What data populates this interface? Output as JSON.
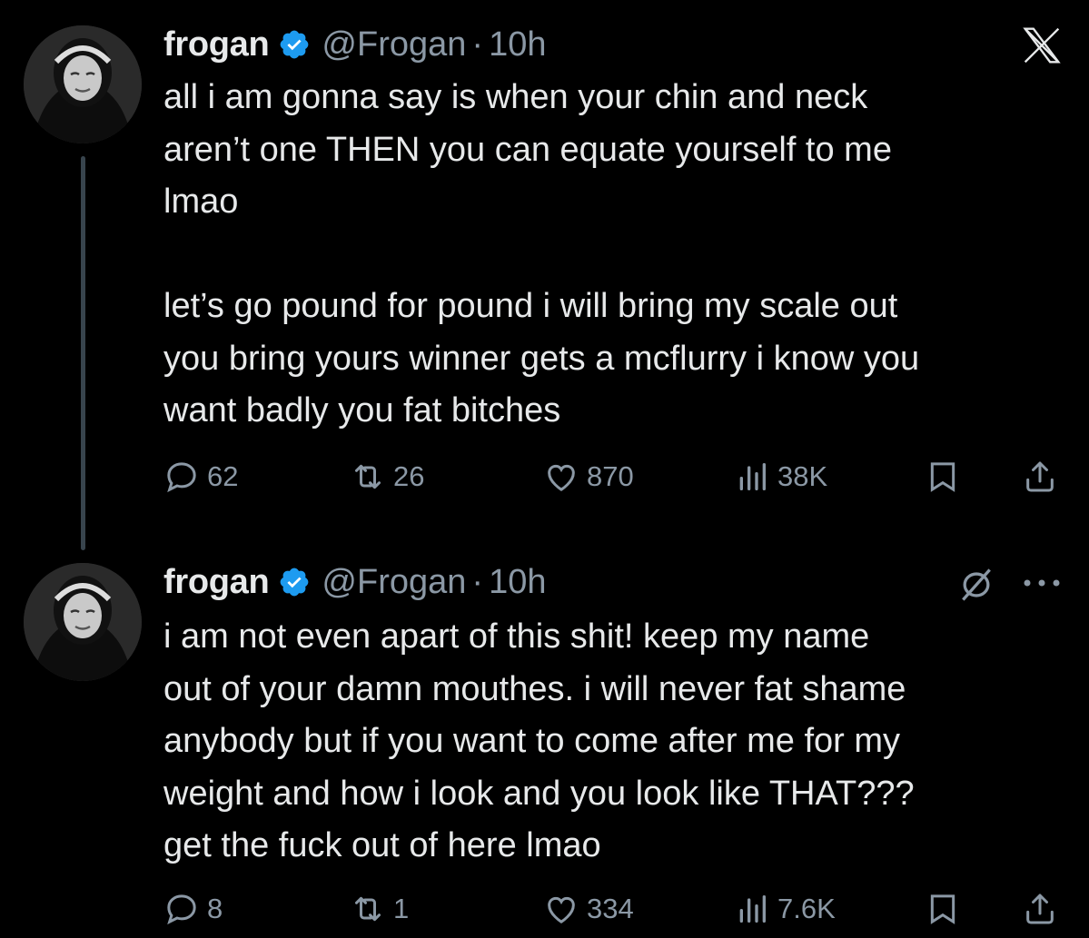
{
  "tweets": [
    {
      "author": {
        "name": "frogan",
        "handle": "@Frogan",
        "verified": true
      },
      "time": "10h",
      "lines": [
        "all i am gonna say is when your chin and neck",
        "aren’t one THEN you can equate yourself to me",
        "lmao",
        "",
        "let’s go pound for pound i will bring my scale out",
        "you bring yours winner gets a mcflurry i know you",
        "want badly you fat bitches"
      ],
      "stats": {
        "replies": "62",
        "reposts": "26",
        "likes": "870",
        "views": "38K"
      },
      "corner_icon": "x-logo-icon"
    },
    {
      "author": {
        "name": "frogan",
        "handle": "@Frogan",
        "verified": true
      },
      "time": "10h",
      "lines": [
        "i am not even apart of this shit! keep my name",
        "out of your damn mouthes. i will never fat shame",
        "anybody but if you want to come after me for my",
        "weight and how i look and you look like THAT???",
        "get the fuck out of here lmao"
      ],
      "stats": {
        "replies": "8",
        "reposts": "1",
        "likes": "334",
        "views": "7.6K"
      },
      "corner_icons": [
        "mute-icon",
        "more-icon"
      ]
    }
  ],
  "colors": {
    "background": "#000000",
    "text": "#e7e9ea",
    "muted": "#8b98a5",
    "verified": "#1d9bf0"
  }
}
